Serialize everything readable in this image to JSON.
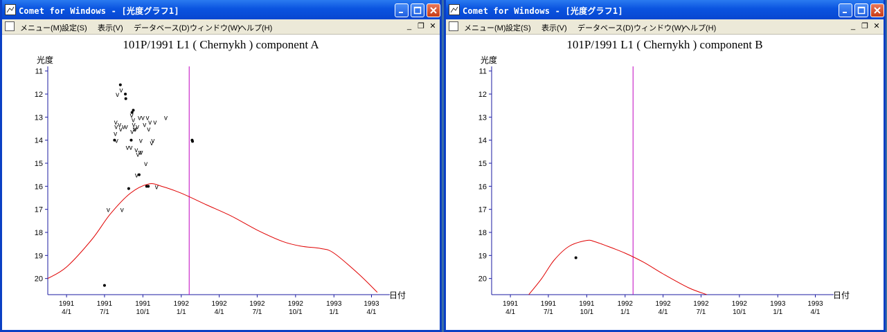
{
  "windows": [
    {
      "id": "left",
      "title": "Comet for Windows - [光度グラフ1]",
      "menu": [
        "メニュー(M)",
        "設定(S)",
        "表示(V)",
        "データベース(D)",
        "ウィンドウ(W)",
        "ヘルプ(H)"
      ],
      "chart_data": {
        "type": "scatter",
        "title": "101P/1991 L1 ( Chernykh ) component A",
        "ylabel": "光度",
        "xlabel": "日付",
        "ylim": [
          20.7,
          10.8
        ],
        "y_inverted": true,
        "yticks": [
          "11",
          "12",
          "13",
          "14",
          "15",
          "16",
          "17",
          "18",
          "19",
          "20"
        ],
        "xlim": [
          "1991-02-15",
          "1993-05-15"
        ],
        "xticks": [
          {
            "year": "1991",
            "md": "4/1"
          },
          {
            "year": "1991",
            "md": "7/1"
          },
          {
            "year": "1991",
            "md": "10/1"
          },
          {
            "year": "1992",
            "md": "1/1"
          },
          {
            "year": "1992",
            "md": "4/1"
          },
          {
            "year": "1992",
            "md": "7/1"
          },
          {
            "year": "1992",
            "md": "10/1"
          },
          {
            "year": "1993",
            "md": "1/1"
          },
          {
            "year": "1993",
            "md": "4/1"
          }
        ],
        "marker_date": "1992-01-20",
        "series": [
          {
            "kind": "curve",
            "color": "#e00000",
            "points": [
              [
                "1991-02-15",
                20.0
              ],
              [
                "1991-04-01",
                19.5
              ],
              [
                "1991-06-01",
                18.3
              ],
              [
                "1991-07-15",
                17.2
              ],
              [
                "1991-09-01",
                16.3
              ],
              [
                "1991-10-15",
                15.9
              ],
              [
                "1991-11-15",
                16.0
              ],
              [
                "1992-01-01",
                16.3
              ],
              [
                "1992-03-01",
                16.8
              ],
              [
                "1992-05-01",
                17.3
              ],
              [
                "1992-07-01",
                17.9
              ],
              [
                "1992-09-01",
                18.4
              ],
              [
                "1992-10-15",
                18.6
              ],
              [
                "1992-12-01",
                18.7
              ],
              [
                "1993-01-01",
                18.9
              ],
              [
                "1993-03-01",
                19.8
              ],
              [
                "1993-04-15",
                20.6
              ]
            ]
          },
          {
            "kind": "observed",
            "color": "#000000",
            "points": [
              [
                "1991-07-01",
                20.3
              ],
              [
                "1991-08-08",
                11.6
              ],
              [
                "1991-08-20",
                12.0
              ],
              [
                "1991-08-21",
                12.2
              ],
              [
                "1991-08-28",
                16.1
              ],
              [
                "1991-07-25",
                14.0
              ],
              [
                "1991-09-05",
                12.8
              ],
              [
                "1991-09-08",
                12.7
              ],
              [
                "1991-09-03",
                14.0
              ],
              [
                "1991-09-22",
                15.5
              ],
              [
                "1991-10-10",
                16.0
              ],
              [
                "1991-10-14",
                16.0
              ],
              [
                "1992-01-27",
                14.0
              ],
              [
                "1992-01-28",
                14.05
              ]
            ]
          },
          {
            "kind": "upper_limit",
            "color": "#000000",
            "points": [
              [
                "1991-07-10",
                17.0
              ],
              [
                "1991-08-10",
                11.8
              ],
              [
                "1991-08-01",
                12.0
              ],
              [
                "1991-07-28",
                13.2
              ],
              [
                "1991-07-29",
                13.4
              ],
              [
                "1991-07-27",
                13.7
              ],
              [
                "1991-07-30",
                14.0
              ],
              [
                "1991-08-06",
                13.3
              ],
              [
                "1991-08-09",
                13.5
              ],
              [
                "1991-08-16",
                13.4
              ],
              [
                "1991-08-22",
                13.4
              ],
              [
                "1991-08-25",
                14.3
              ],
              [
                "1991-09-02",
                14.3
              ],
              [
                "1991-09-04",
                12.9
              ],
              [
                "1991-09-05",
                13.6
              ],
              [
                "1991-09-08",
                13.1
              ],
              [
                "1991-09-09",
                13.3
              ],
              [
                "1991-09-11",
                13.5
              ],
              [
                "1991-09-15",
                14.4
              ],
              [
                "1991-09-18",
                13.4
              ],
              [
                "1991-09-19",
                14.6
              ],
              [
                "1991-09-23",
                13.0
              ],
              [
                "1991-09-24",
                14.5
              ],
              [
                "1991-09-26",
                14.0
              ],
              [
                "1991-09-27",
                14.5
              ],
              [
                "1991-10-01",
                13.0
              ],
              [
                "1991-10-05",
                13.3
              ],
              [
                "1991-10-08",
                15.0
              ],
              [
                "1991-10-12",
                13.0
              ],
              [
                "1991-10-15",
                13.5
              ],
              [
                "1991-10-18",
                13.2
              ],
              [
                "1991-10-22",
                14.1
              ],
              [
                "1991-10-25",
                14.0
              ],
              [
                "1991-10-30",
                13.2
              ],
              [
                "1991-11-03",
                16.0
              ],
              [
                "1991-11-25",
                13.0
              ],
              [
                "1991-08-12",
                17.0
              ],
              [
                "1991-09-13",
                13.5
              ],
              [
                "1991-09-16",
                15.5
              ]
            ]
          }
        ]
      }
    },
    {
      "id": "right",
      "title": "Comet for Windows - [光度グラフ1]",
      "menu": [
        "メニュー(M)",
        "設定(S)",
        "表示(V)",
        "データベース(D)",
        "ウィンドウ(W)",
        "ヘルプ(H)"
      ],
      "chart_data": {
        "type": "scatter",
        "title": "101P/1991 L1 ( Chernykh ) component B",
        "ylabel": "光度",
        "xlabel": "日付",
        "ylim": [
          20.7,
          10.8
        ],
        "y_inverted": true,
        "yticks": [
          "11",
          "12",
          "13",
          "14",
          "15",
          "16",
          "17",
          "18",
          "19",
          "20"
        ],
        "xlim": [
          "1991-02-15",
          "1993-05-15"
        ],
        "xticks": [
          {
            "year": "1991",
            "md": "4/1"
          },
          {
            "year": "1991",
            "md": "7/1"
          },
          {
            "year": "1991",
            "md": "10/1"
          },
          {
            "year": "1992",
            "md": "1/1"
          },
          {
            "year": "1992",
            "md": "4/1"
          },
          {
            "year": "1992",
            "md": "7/1"
          },
          {
            "year": "1992",
            "md": "10/1"
          },
          {
            "year": "1993",
            "md": "1/1"
          },
          {
            "year": "1993",
            "md": "4/1"
          }
        ],
        "marker_date": "1992-01-20",
        "series": [
          {
            "kind": "curve",
            "color": "#e00000",
            "points": [
              [
                "1991-05-15",
                20.7
              ],
              [
                "1991-06-15",
                20.0
              ],
              [
                "1991-07-15",
                19.2
              ],
              [
                "1991-08-20",
                18.6
              ],
              [
                "1991-10-01",
                18.35
              ],
              [
                "1991-10-20",
                18.4
              ],
              [
                "1991-11-20",
                18.6
              ],
              [
                "1992-01-01",
                18.9
              ],
              [
                "1992-02-15",
                19.3
              ],
              [
                "1992-04-01",
                19.8
              ],
              [
                "1992-06-01",
                20.4
              ],
              [
                "1992-07-15",
                20.7
              ]
            ]
          },
          {
            "kind": "observed",
            "color": "#000000",
            "points": [
              [
                "1991-09-05",
                19.1
              ]
            ]
          }
        ]
      }
    }
  ]
}
